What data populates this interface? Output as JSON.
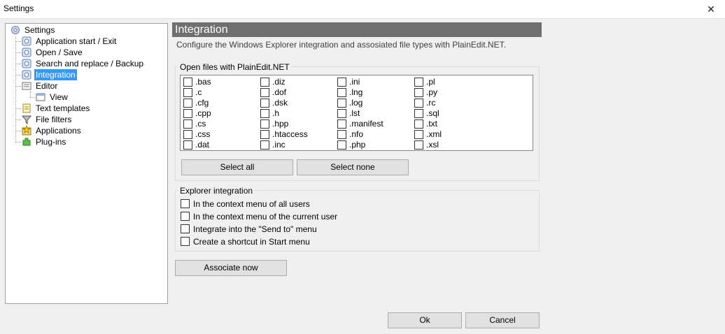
{
  "window": {
    "title": "Settings",
    "close_glyph": "✕"
  },
  "tree": {
    "root": "Settings",
    "items": [
      {
        "label": "Application start / Exit",
        "icon": "settings-page-icon"
      },
      {
        "label": "Open / Save",
        "icon": "settings-page-icon"
      },
      {
        "label": "Search and replace / Backup",
        "icon": "settings-page-icon"
      },
      {
        "label": "Integration",
        "icon": "settings-page-icon",
        "selected": true
      },
      {
        "label": "Editor",
        "icon": "editor-icon"
      },
      {
        "label": "View",
        "icon": "view-icon"
      },
      {
        "label": "Text templates",
        "icon": "templates-icon"
      },
      {
        "label": "File filters",
        "icon": "filter-icon"
      },
      {
        "label": "Applications",
        "icon": "applications-icon"
      },
      {
        "label": "Plug-ins",
        "icon": "plugin-icon"
      }
    ]
  },
  "header": {
    "title": "Integration",
    "description": "Configure the Windows Explorer integration and assosiated file types with PlainEdit.NET."
  },
  "open_files": {
    "title": "Open files with PlainEdit.NET",
    "columns": [
      [
        ".bas",
        ".c",
        ".cfg",
        ".cpp",
        ".cs",
        ".css",
        ".dat"
      ],
      [
        ".diz",
        ".dof",
        ".dsk",
        ".h",
        ".hpp",
        ".htaccess",
        ".inc"
      ],
      [
        ".ini",
        ".lng",
        ".log",
        ".lst",
        ".manifest",
        ".nfo",
        ".php"
      ],
      [
        ".pl",
        ".py",
        ".rc",
        ".sql",
        ".txt",
        ".xml",
        ".xsl"
      ]
    ],
    "select_all": "Select all",
    "select_none": "Select none"
  },
  "explorer": {
    "title": "Explorer integration",
    "options": [
      "In the context menu of all users",
      "In the context menu of the current user",
      "Integrate into the \"Send to\" menu",
      "Create a shortcut in Start menu"
    ]
  },
  "associate_label": "Associate now",
  "ok_label": "Ok",
  "cancel_label": "Cancel"
}
